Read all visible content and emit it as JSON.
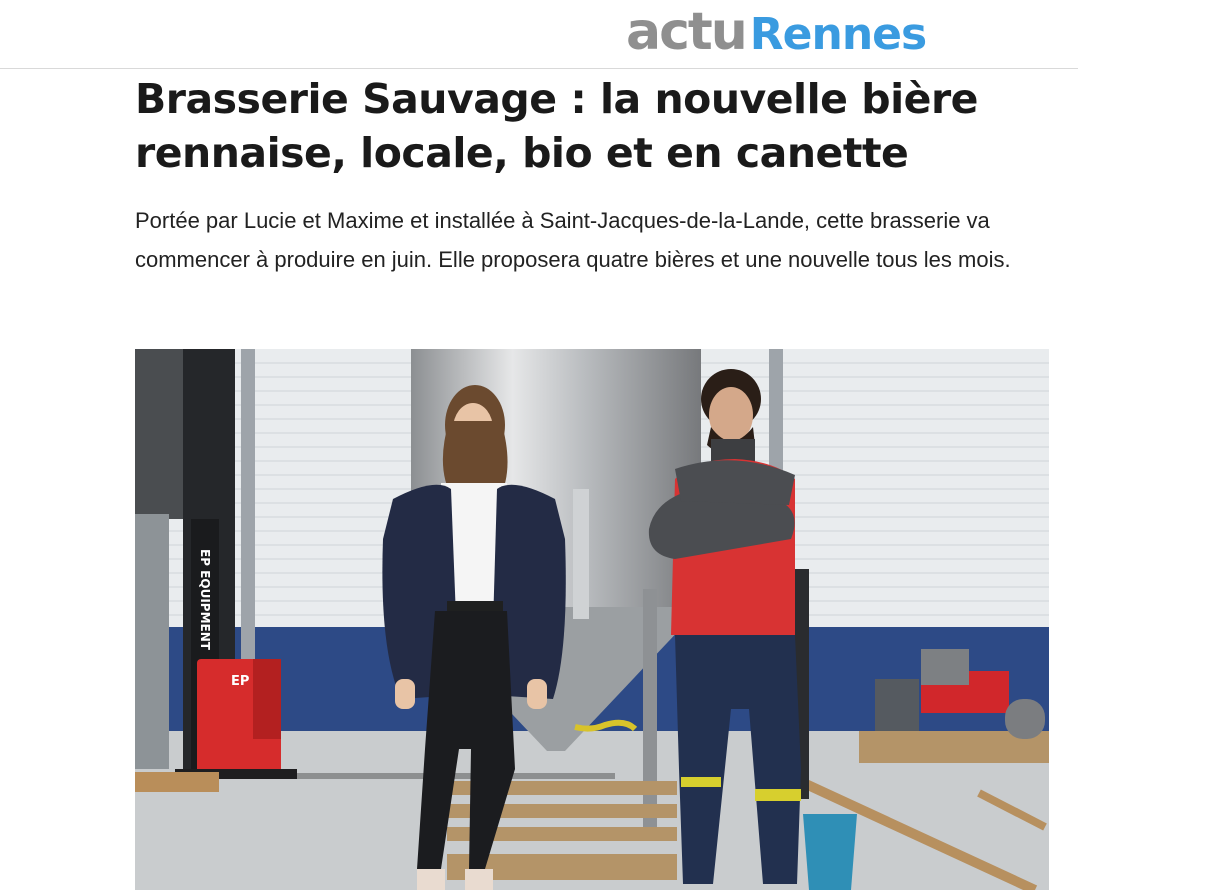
{
  "site": {
    "logo_part1": "actu",
    "logo_part2": "Rennes"
  },
  "article": {
    "title": "Brasserie Sauvage : la nouvelle bière rennaise, locale, bio et en canette",
    "lede": "Portée par Lucie et Maxime et installée à Saint-Jacques-de-la-Lande, cette brasserie va commencer à produire en juin. Elle proposera quatre bières et une nouvelle tous les mois.",
    "image": {
      "icon": "photo-brewery",
      "forklift_text": "EP EQUIPMENT",
      "forklift_badge": "EP"
    }
  },
  "colors": {
    "logo_grey": "#8f8f8f",
    "logo_blue": "#3a9be0",
    "text": "#1a1a1a"
  }
}
